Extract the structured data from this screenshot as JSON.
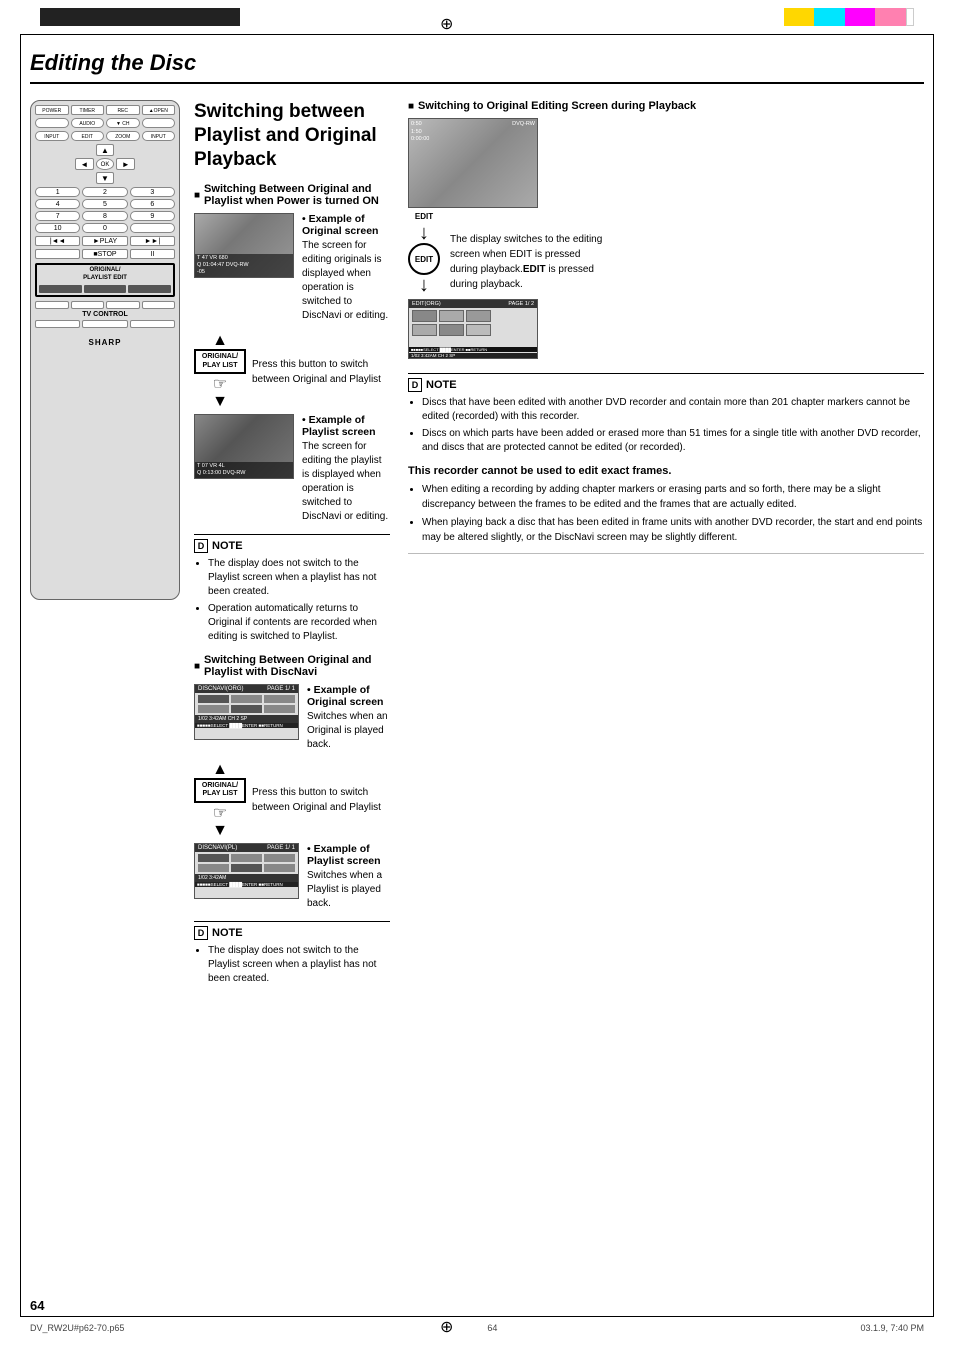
{
  "page": {
    "title": "Editing the Disc",
    "number": "64",
    "footer_left": "DV_RW2U#p62-70.p65",
    "footer_center": "64",
    "footer_right": "03.1.9, 7:40 PM"
  },
  "colors": {
    "yellow": "#FFFF00",
    "cyan": "#00FFFF",
    "magenta": "#FF00FF",
    "pink": "#FF80C0",
    "black": "#000000",
    "white": "#FFFFFF"
  },
  "top_bar": {
    "left_color": "#222222",
    "colors": [
      "#FFD700",
      "#00BFFF",
      "#FF1493",
      "#FF69B4"
    ]
  },
  "section": {
    "main_heading": "Switching between Playlist and Original Playback",
    "sub1": {
      "heading": "Switching Between Original and Playlist when Power is turned ON",
      "example_original_label": "• Example of Original screen",
      "example_original_text": "The screen for editing originals is displayed when operation is switched to DiscNavi or editing.",
      "button_label": "ORIGINAL/\nPLAY LIST",
      "press_text": "Press this button to switch between Original and Playlist",
      "example_playlist_label": "• Example of Playlist screen",
      "example_playlist_text": "The screen for editing the playlist is displayed when operation is switched to DiscNavi or editing."
    },
    "note1": {
      "header": "NOTE",
      "items": [
        "The display does not switch to the Playlist screen when a playlist has not been created.",
        "Operation automatically returns to Original if contents are recorded when editing is switched to Playlist."
      ]
    },
    "sub2": {
      "heading": "Switching Between Original and Playlist with DiscNavi",
      "example_original_label": "• Example of Original screen",
      "example_original_text": "Switches when an Original is played back.",
      "button_label": "ORIGINAL/\nPLAY LIST",
      "press_text": "Press this button to switch between Original and Playlist",
      "example_playlist_label": "• Example of Playlist screen",
      "example_playlist_text": "Switches when a Playlist is played back."
    },
    "note2": {
      "header": "NOTE",
      "items": [
        "The display does not switch to the Playlist screen when a playlist has not been created."
      ]
    },
    "sub3": {
      "heading": "Switching to Original Editing Screen during Playback",
      "edit_button_label": "EDIT",
      "description": "The display switches to the editing screen when EDIT is pressed during playback.",
      "description_bold": "EDIT"
    },
    "note3": {
      "header": "NOTE",
      "items": [
        "Discs that have been edited with another DVD recorder and contain more than 201 chapter markers cannot be edited (recorded) with this recorder.",
        "Discs on which parts have been added or erased more than 51 times for a single title with another DVD recorder, and discs that are protected cannot be edited (or recorded)."
      ]
    },
    "frames_heading": "This recorder cannot be used to edit exact frames.",
    "frames_bullets": [
      "When editing a recording by adding chapter markers or erasing parts and so forth, there may be a slight discrepancy between the frames to be edited and the frames that are actually edited.",
      "When playing back a disc that has been edited in frame units with another DVD recorder, the start and end points may be altered slightly, or the DiscNavi screen may be slightly different."
    ]
  }
}
